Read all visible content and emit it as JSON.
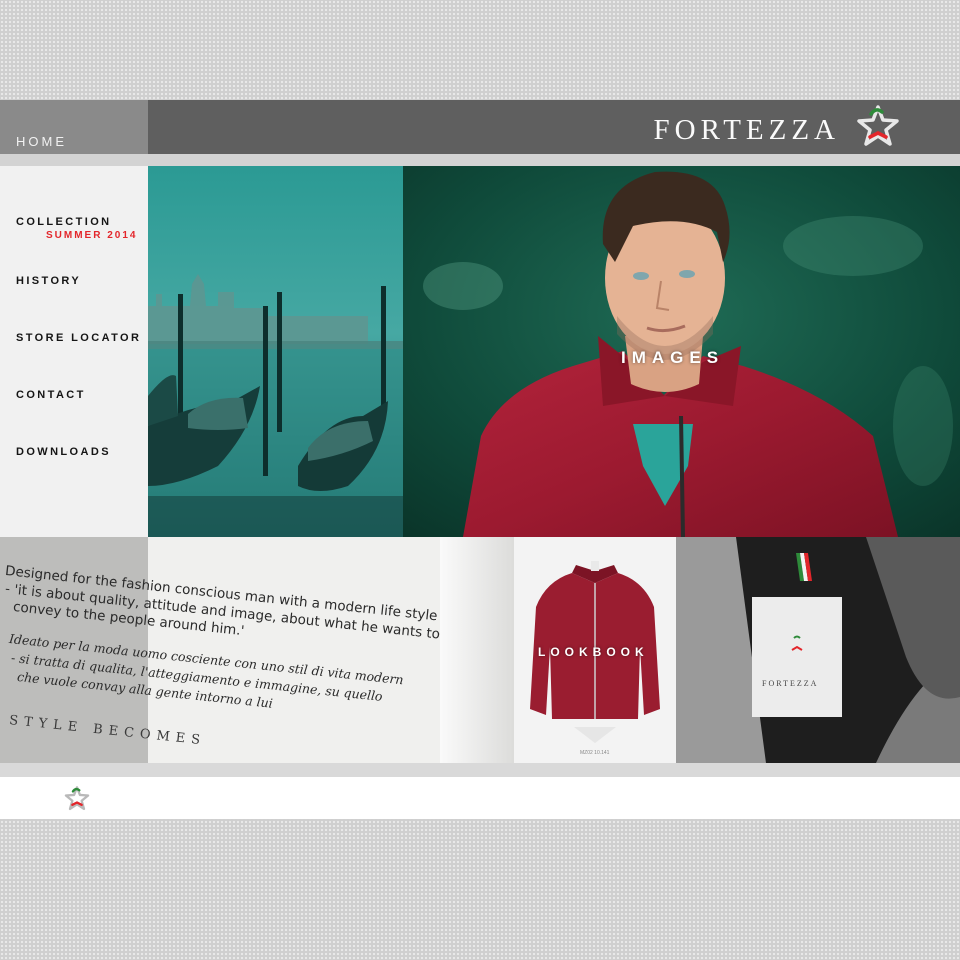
{
  "brand": {
    "name": "FORTEZZA",
    "colors": {
      "accent_red": "#e3262b",
      "header_gray": "#5f5f5f",
      "flag_green": "#2e8b3a"
    }
  },
  "header": {
    "home_label": "HOME",
    "logo_text": "FORTEZZA",
    "logo_icon": "star-flag-icon"
  },
  "sidebar": {
    "items": [
      {
        "label": "COLLECTION",
        "sub": "SUMMER 2014"
      },
      {
        "label": "HISTORY"
      },
      {
        "label": "STORE LOCATOR"
      },
      {
        "label": "CONTACT"
      },
      {
        "label": "DOWNLOADS"
      }
    ]
  },
  "tiles": {
    "images_label": "IMAGES",
    "lookbook_label": "LOOKBOOK",
    "lookbook_code": "MZ02 10.141",
    "jacket_label_brand": "FORTEZZA",
    "print": {
      "en_line1": "Designed for the fashion conscious man with a modern life style",
      "en_line2": "- 'it is about quality, attitude and image, about what he wants to",
      "en_line3": "convey to the people around him.'",
      "it_line1": "Ideato per la moda uomo cosciente con uno stil   di vita modern",
      "it_line2": "- si tratta di qualita, l'atteggiamento e immagine, su quello",
      "it_line3": "che vuole convay alla gente intorno a lui",
      "motto": "STYLE BECOMES"
    }
  },
  "footer": {
    "icon": "star-flag-icon"
  }
}
